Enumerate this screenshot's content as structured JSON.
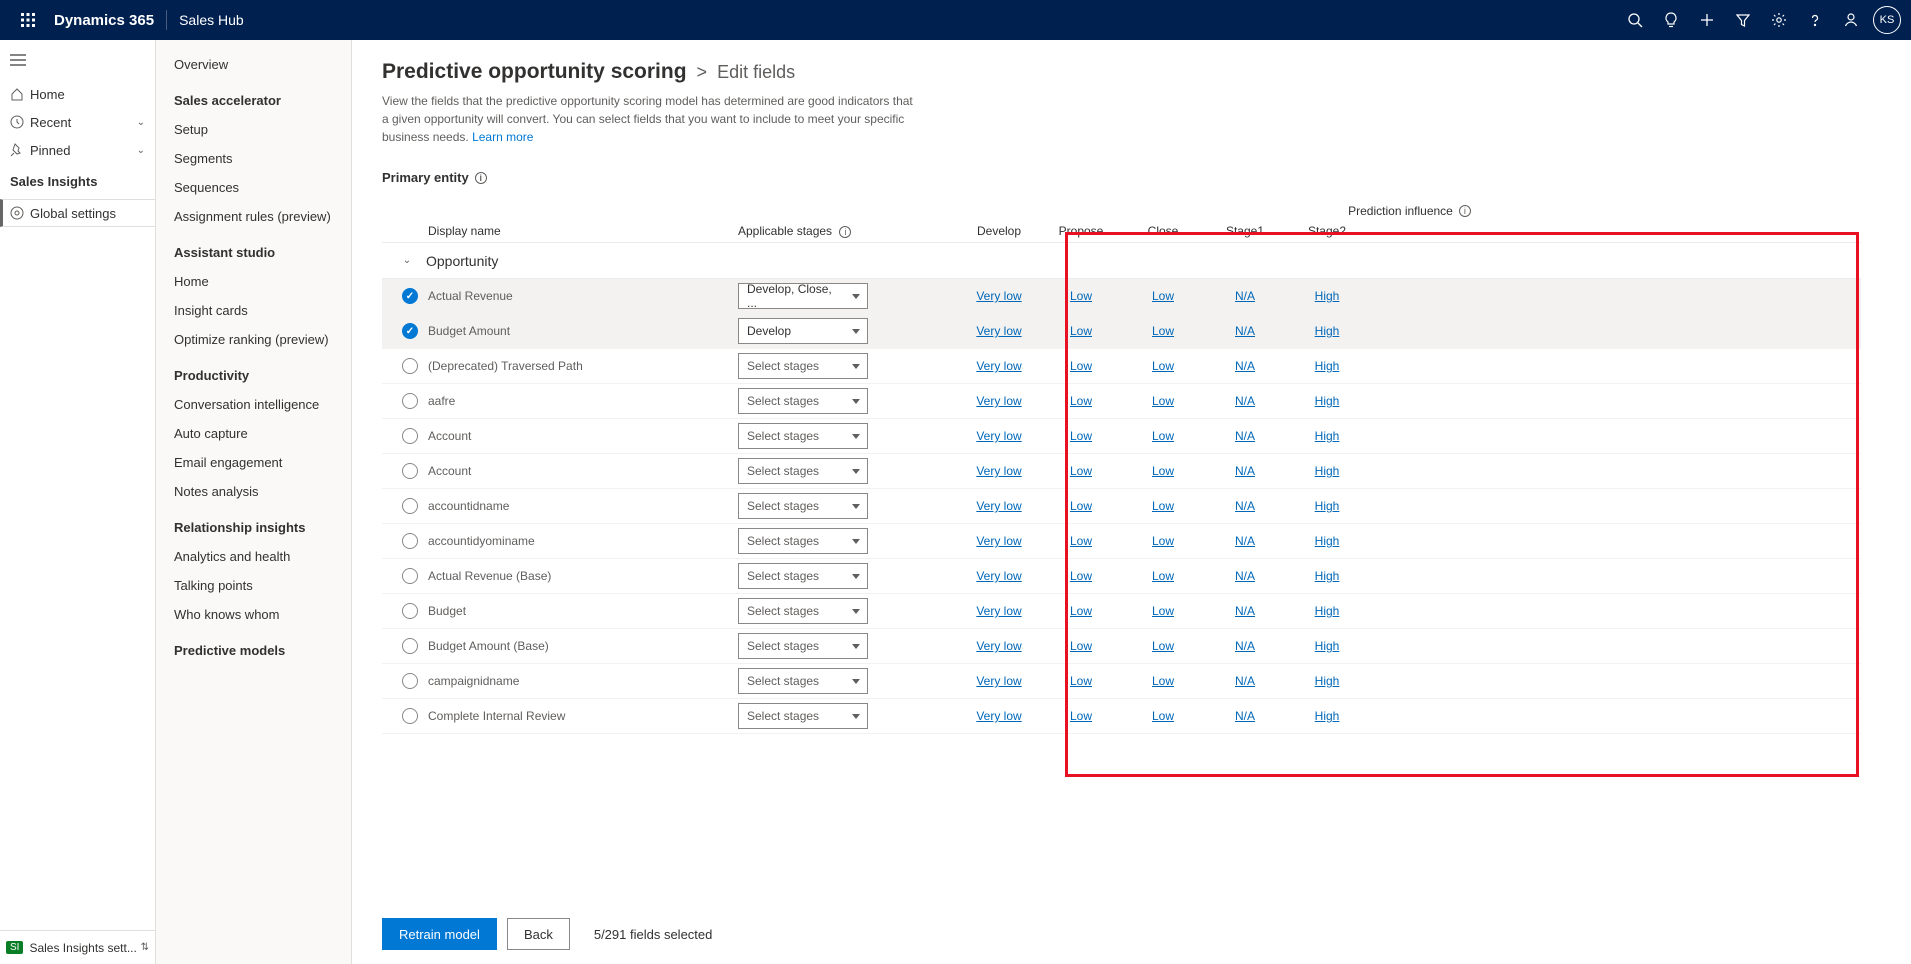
{
  "topbar": {
    "brand": "Dynamics 365",
    "app": "Sales Hub",
    "avatar_initials": "KS"
  },
  "leftnav": {
    "items": [
      {
        "label": "Home"
      },
      {
        "label": "Recent"
      },
      {
        "label": "Pinned"
      }
    ],
    "section": "Sales Insights",
    "selected": "Global settings",
    "switcher_badge": "SI",
    "switcher_label": "Sales Insights sett..."
  },
  "secnav": {
    "groups": [
      {
        "header": null,
        "items": [
          "Overview"
        ]
      },
      {
        "header": "Sales accelerator",
        "items": [
          "Setup",
          "Segments",
          "Sequences",
          "Assignment rules (preview)"
        ]
      },
      {
        "header": "Assistant studio",
        "items": [
          "Home",
          "Insight cards",
          "Optimize ranking (preview)"
        ]
      },
      {
        "header": "Productivity",
        "items": [
          "Conversation intelligence",
          "Auto capture",
          "Email engagement",
          "Notes analysis"
        ]
      },
      {
        "header": "Relationship insights",
        "items": [
          "Analytics and health",
          "Talking points",
          "Who knows whom"
        ]
      },
      {
        "header": "Predictive models",
        "items": []
      }
    ]
  },
  "main": {
    "breadcrumb_root": "Predictive opportunity scoring",
    "breadcrumb_leaf": "Edit fields",
    "description": "View the fields that the predictive opportunity scoring model has determined are good indicators that a given opportunity will convert. You can select fields that you want to include to meet your specific business needs.",
    "learn_more": "Learn more",
    "primary_entity_label": "Primary entity",
    "columns": {
      "display_name": "Display name",
      "applicable_stages": "Applicable stages",
      "prediction_influence": "Prediction influence",
      "stages": [
        "Develop",
        "Propose",
        "Close",
        "Stage1",
        "Stage2"
      ]
    },
    "group_name": "Opportunity",
    "select_placeholder": "Select stages",
    "rows": [
      {
        "checked": true,
        "name": "Actual Revenue",
        "stages_value": "Develop, Close, ...",
        "influence": [
          "Very low",
          "Low",
          "Low",
          "N/A",
          "High"
        ]
      },
      {
        "checked": true,
        "name": "Budget Amount",
        "stages_value": "Develop",
        "influence": [
          "Very low",
          "Low",
          "Low",
          "N/A",
          "High"
        ]
      },
      {
        "checked": false,
        "name": "(Deprecated) Traversed Path",
        "stages_value": null,
        "influence": [
          "Very low",
          "Low",
          "Low",
          "N/A",
          "High"
        ]
      },
      {
        "checked": false,
        "name": "aafre",
        "stages_value": null,
        "influence": [
          "Very low",
          "Low",
          "Low",
          "N/A",
          "High"
        ]
      },
      {
        "checked": false,
        "name": "Account",
        "stages_value": null,
        "influence": [
          "Very low",
          "Low",
          "Low",
          "N/A",
          "High"
        ]
      },
      {
        "checked": false,
        "name": "Account",
        "stages_value": null,
        "influence": [
          "Very low",
          "Low",
          "Low",
          "N/A",
          "High"
        ]
      },
      {
        "checked": false,
        "name": "accountidname",
        "stages_value": null,
        "influence": [
          "Very low",
          "Low",
          "Low",
          "N/A",
          "High"
        ]
      },
      {
        "checked": false,
        "name": "accountidyominame",
        "stages_value": null,
        "influence": [
          "Very low",
          "Low",
          "Low",
          "N/A",
          "High"
        ]
      },
      {
        "checked": false,
        "name": "Actual Revenue (Base)",
        "stages_value": null,
        "influence": [
          "Very low",
          "Low",
          "Low",
          "N/A",
          "High"
        ]
      },
      {
        "checked": false,
        "name": "Budget",
        "stages_value": null,
        "influence": [
          "Very low",
          "Low",
          "Low",
          "N/A",
          "High"
        ]
      },
      {
        "checked": false,
        "name": "Budget Amount (Base)",
        "stages_value": null,
        "influence": [
          "Very low",
          "Low",
          "Low",
          "N/A",
          "High"
        ]
      },
      {
        "checked": false,
        "name": "campaignidname",
        "stages_value": null,
        "influence": [
          "Very low",
          "Low",
          "Low",
          "N/A",
          "High"
        ]
      },
      {
        "checked": false,
        "name": "Complete Internal Review",
        "stages_value": null,
        "influence": [
          "Very low",
          "Low",
          "Low",
          "N/A",
          "High"
        ]
      }
    ],
    "footer": {
      "retrain_label": "Retrain model",
      "back_label": "Back",
      "count_text": "5/291 fields selected"
    }
  }
}
